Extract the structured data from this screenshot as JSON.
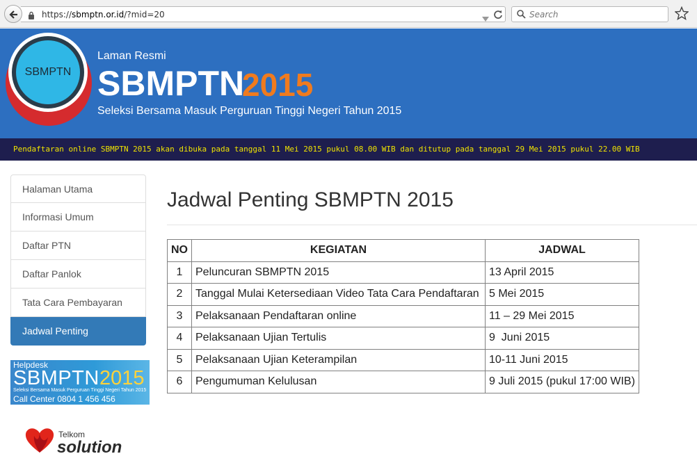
{
  "browser": {
    "url_prefix": "https://",
    "url_host": "sbmptn.or.id",
    "url_path": "/?mid=20",
    "search_placeholder": "Search"
  },
  "banner": {
    "logo_text": "SBMPTN",
    "laman": "Laman Resmi",
    "title": "SBMPTN",
    "year": "2015",
    "subtitle": "Seleksi Bersama Masuk Perguruan Tinggi Negeri Tahun 2015"
  },
  "marquee": {
    "text": "Pendaftaran online SBMPTN 2015 akan dibuka pada tanggal 11 Mei 2015 pukul 08.00 WIB dan ditutup pada tanggal 29 Mei 2015 pukul 22.00 WIB"
  },
  "sidebar": {
    "items": [
      {
        "label": "Halaman Utama"
      },
      {
        "label": "Informasi Umum"
      },
      {
        "label": "Daftar PTN"
      },
      {
        "label": "Daftar Panlok"
      },
      {
        "label": "Tata Cara Pembayaran"
      },
      {
        "label": "Jadwal Penting"
      }
    ],
    "active": "Jadwal Penting"
  },
  "helpdesk": {
    "label": "Helpdesk",
    "title": "SBMPTN",
    "year": "2015",
    "sub": "Seleksi Bersama Masuk Perguruan Tinggi Negeri Tahun 2015",
    "call": "Call Center 0804 1 456 456"
  },
  "sponsor": {
    "telkom": "Telkom",
    "solution": "solution"
  },
  "main": {
    "page_title": "Jadwal Penting SBMPTN 2015",
    "table": {
      "headers": [
        "NO",
        "KEGIATAN",
        "JADWAL"
      ],
      "rows": [
        [
          "1",
          "Peluncuran SBMPTN 2015",
          "13 April 2015"
        ],
        [
          "2",
          "Tanggal Mulai Ketersediaan Video Tata Cara Pendaftaran",
          "5 Mei 2015"
        ],
        [
          "3",
          "Pelaksanaan Pendaftaran online",
          "11 – 29 Mei 2015"
        ],
        [
          "4",
          "Pelaksanaan Ujian Tertulis",
          "9  Juni 2015"
        ],
        [
          "5",
          "Pelaksanaan Ujian Keterampilan",
          "10-11 Juni 2015"
        ],
        [
          "6",
          "Pengumuman Kelulusan",
          "9 Juli 2015 (pukul 17:00 WIB)"
        ]
      ]
    }
  },
  "colors": {
    "banner": "#2d6fc0",
    "year_accent": "#f07b1e",
    "marquee_bg": "#1e1e4e",
    "marquee_text": "#f0e400",
    "active_nav": "#337ab7"
  }
}
